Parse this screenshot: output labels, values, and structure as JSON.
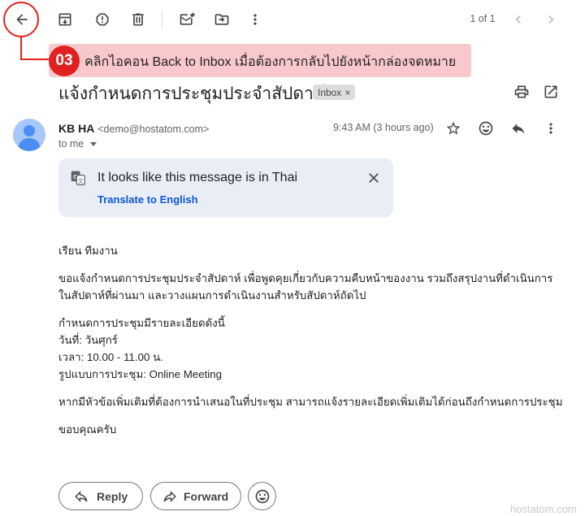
{
  "toolbar": {
    "icons": [
      "back-arrow-icon",
      "archive-icon",
      "report-spam-icon",
      "delete-icon",
      "mark-unread-icon",
      "move-to-icon",
      "more-vert-icon"
    ],
    "pager_text": "1 of 1"
  },
  "callout": {
    "number": "03",
    "text": "คลิกไอคอน Back to Inbox เมื่อต้องการกลับไปยังหน้ากล่องจดหมาย",
    "color": "#e0211f",
    "bg_color": "#f9c8cc"
  },
  "email": {
    "subject": "แจ้งกำหนดการประชุมประจำสัปดาห์",
    "label": "Inbox",
    "label_remove": "×",
    "sender_name": "KB HA",
    "sender_email": "<demo@hostatom.com>",
    "to_text": "to me",
    "time": "9:43 AM (3 hours ago)"
  },
  "translate": {
    "title": "It looks like this message is in Thai",
    "link": "Translate to English"
  },
  "body": {
    "greeting": "เรียน ทีมงาน",
    "para1_line1": "ขอแจ้งกำหนดการประชุมประจำสัปดาห์ เพื่อพูดคุยเกี่ยวกับความคืบหน้าของงาน รวมถึงสรุปงานที่ดำเนินการ",
    "para1_line2": "ในสัปดาห์ที่ผ่านมา และวางแผนการดำเนินงานสำหรับสัปดาห์ถัดไป",
    "details_title": "กำหนดการประชุมมีรายละเอียดดังนี้",
    "details_day": "วันที่: วันศุกร์",
    "details_time": "เวลา: 10.00 - 11.00 น.",
    "details_format": "รูปแบบการประชุม: Online Meeting",
    "para2": "หากมีหัวข้อเพิ่มเติมที่ต้องการนำเสนอในที่ประชุม สามารถแจ้งรายละเอียดเพิ่มเติมได้ก่อนถึงกำหนดการประชุม",
    "closing": "ขอบคุณครับ"
  },
  "actions": {
    "reply": "Reply",
    "forward": "Forward"
  },
  "watermark": "hostatom.com",
  "colors": {
    "link_blue": "#0b57d0",
    "translate_bg": "#e9eef6",
    "avatar_bg": "#a8c7fa"
  }
}
